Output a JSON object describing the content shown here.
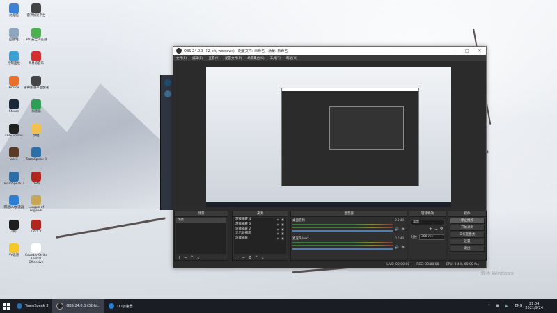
{
  "desktop": {
    "icons": [
      {
        "label": "此电脑",
        "icon": "computer-icon",
        "color": "#3b82d6"
      },
      {
        "label": "雷神加速平台",
        "icon": "app-icon",
        "color": "#444444"
      },
      {
        "label": "回收站",
        "icon": "recycle-bin-icon",
        "color": "#8fa6bf"
      },
      {
        "label": "360安全浏览器",
        "icon": "browser-icon",
        "color": "#4caf50"
      },
      {
        "label": "控制面板",
        "icon": "control-panel-icon",
        "color": "#3aa0d8"
      },
      {
        "label": "网易云音乐",
        "icon": "music-icon",
        "color": "#d42f2f"
      },
      {
        "label": "Firefox",
        "icon": "firefox-icon",
        "color": "#e96f2b"
      },
      {
        "label": "雷神加速平台加速",
        "icon": "app-icon",
        "color": "#444444"
      },
      {
        "label": "Steam",
        "icon": "steam-icon",
        "color": "#1b2838"
      },
      {
        "label": "加速器",
        "icon": "accelerator-icon",
        "color": "#2f9e55"
      },
      {
        "label": "OBS Studio",
        "icon": "obs-icon",
        "color": "#222222"
      },
      {
        "label": "文档",
        "icon": "folder-icon",
        "color": "#f2c04e"
      },
      {
        "label": "war3",
        "icon": "game-icon",
        "color": "#5a3a24"
      },
      {
        "label": "TeamSpeak 3",
        "icon": "teamspeak-icon",
        "color": "#2c6ea8"
      },
      {
        "label": "TeamSpeak 3",
        "icon": "teamspeak-icon",
        "color": "#2c6ea8"
      },
      {
        "label": "Dota",
        "icon": "game-icon",
        "color": "#b3261e"
      },
      {
        "label": "网易UU加速器",
        "icon": "uu-icon",
        "color": "#2a7fd4"
      },
      {
        "label": "League of Legends",
        "icon": "game-icon",
        "color": "#c8a655"
      },
      {
        "label": "QQ",
        "icon": "qq-icon",
        "color": "#1e1e1e"
      },
      {
        "label": "Dota 2",
        "icon": "game-icon",
        "color": "#b3261e"
      },
      {
        "label": "YY语音",
        "icon": "yy-icon",
        "color": "#f4c82a"
      },
      {
        "label": "Counter-Strike Global Offensive",
        "icon": "game-icon",
        "color": "#ffffff"
      }
    ]
  },
  "obs": {
    "title": "OBS 24.0.3 (32-bit, windows) - 配置文件: 未命名 - 场景: 未命名",
    "menus": [
      "文件(F)",
      "编辑(E)",
      "查看(V)",
      "配置文件(P)",
      "场景集合(S)",
      "工具(T)",
      "帮助(H)"
    ],
    "docks": {
      "scenes": {
        "title": "场景",
        "items": [
          "场景"
        ]
      },
      "sources": {
        "title": "来源",
        "items": [
          "游戏捕获 4",
          "游戏捕获 3",
          "游戏捕获 2",
          "显示器捕获",
          "游戏捕获"
        ]
      },
      "mixer": {
        "title": "混音器",
        "channels": [
          {
            "name": "桌面音频",
            "db": "0.0 dB"
          },
          {
            "name": "麦克风/Aux",
            "db": "0.0 dB"
          }
        ]
      },
      "transitions": {
        "title": "转场特效",
        "type": "淡出",
        "duration_label": "时长",
        "duration": "300 ms"
      },
      "controls": {
        "title": "控件",
        "buttons": [
          "停止推流",
          "开始录制",
          "工作室模式",
          "设置",
          "退出"
        ]
      }
    },
    "status": {
      "live": "LIVE: 00:00:00",
      "rec": "REC: 00:00:00",
      "cpu": "CPU: 0.4%, 60.00 fps"
    }
  },
  "taskbar": {
    "items": [
      {
        "label": "TeamSpeak 3",
        "icon": "teamspeak-icon",
        "color": "#2c6ea8"
      },
      {
        "label": "OBS 24.0.3 (32-bi...",
        "icon": "obs-icon",
        "color": "#222222"
      },
      {
        "label": "UU加速器",
        "icon": "uu-icon",
        "color": "#2a7fd4"
      }
    ],
    "lang": "ENG",
    "time": "21:04",
    "date": "2021/9/24"
  },
  "watermark": "激活 Windows"
}
